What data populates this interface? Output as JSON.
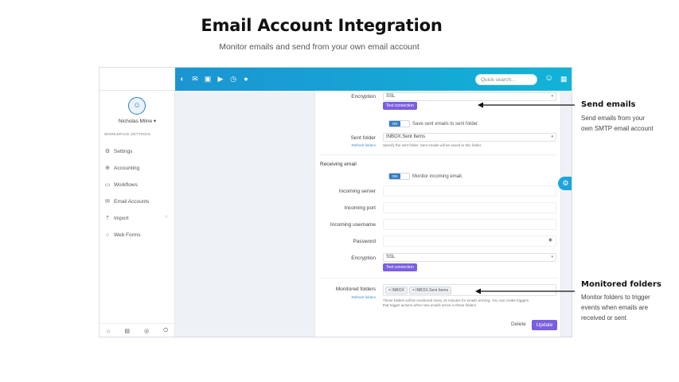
{
  "hero": {
    "title": "Email Account Integration",
    "subtitle": "Monitor emails and send from your own email account"
  },
  "topbar": {
    "icons": [
      "dashboard-icon",
      "mail-icon",
      "contacts-icon",
      "play-icon",
      "clock-icon",
      "user-icon"
    ],
    "search_placeholder": "Quick search...",
    "accent_start": "#1d8fd0",
    "accent_end": "#12b3d8"
  },
  "sidebar": {
    "username": "Nicholas Milne",
    "section_label": "WORKSPACE SETTINGS",
    "items": [
      {
        "label": "Settings",
        "icon": "gear-icon"
      },
      {
        "label": "Accounting",
        "icon": "accounting-icon"
      },
      {
        "label": "Workflows",
        "icon": "workflow-icon"
      },
      {
        "label": "Email Accounts",
        "icon": "mail-icon"
      },
      {
        "label": "Import",
        "icon": "upload-icon"
      },
      {
        "label": "Web Forms",
        "icon": "chat-icon"
      }
    ]
  },
  "form": {
    "encryption_label": "Encryption",
    "encryption_value": "SSL",
    "test_connection": "Test connection",
    "toggle_on": "ON",
    "save_sent_label": "Save sent emails to sent folder.",
    "sent_folder_label": "Sent folder",
    "refresh_folders": "Refresh folders",
    "sent_folder_value": "INBOX.Sent Items",
    "sent_folder_hint": "Specify the sent folder. Sent emails will be saved to this folder.",
    "receiving_title": "Receiving email",
    "monitor_label": "Monitor incoming email.",
    "incoming_server_label": "Incoming server",
    "incoming_port_label": "Incoming port",
    "incoming_username_label": "Incoming username",
    "password_label": "Password",
    "encryption2_label": "Encryption",
    "encryption2_value": "SSL",
    "test_connection2": "Test connection",
    "monitored_folders_label": "Monitored folders",
    "refresh_folders2": "Refresh folders",
    "folders": [
      "× INBOX",
      "× INBOX.Sent Items"
    ],
    "folders_hint_1": "These folders will be monitored every 15 minutes for emails arriving. You can create triggers",
    "folders_hint_2": "that trigger actions when new emails arrive in these folders.",
    "delete_label": "Delete",
    "update_label": "Update",
    "button_color": "#7b5fe0"
  },
  "callouts": {
    "send_title": "Send emails",
    "send_text_1": "Send emails from your",
    "send_text_2": "own SMTP email account",
    "monitor_title": "Monitored folders",
    "monitor_text_1": "Monitor folders to trigger",
    "monitor_text_2": "events when emails are",
    "monitor_text_3": "received or sent"
  }
}
